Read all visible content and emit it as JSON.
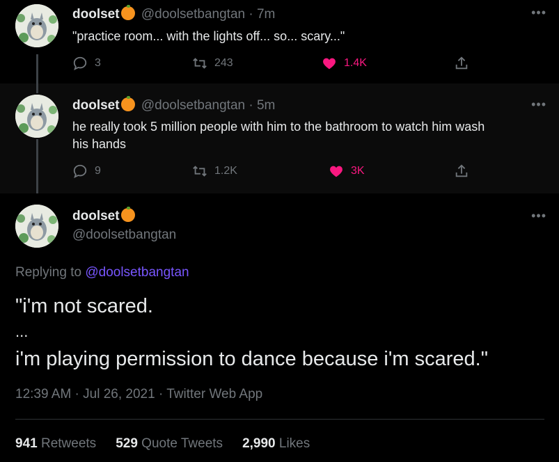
{
  "tweets": [
    {
      "name": "doolset",
      "handle": "@doolsetbangtan",
      "time": "· 7m",
      "text": "\"practice room... with the lights off... so... scary...\"",
      "replies": "3",
      "retweets": "243",
      "likes": "1.4K"
    },
    {
      "name": "doolset",
      "handle": "@doolsetbangtan",
      "time": "· 5m",
      "text_line1": "he really took 5 million people with him to the bathroom to watch him wash",
      "text_line2": "his hands",
      "replies": "9",
      "retweets": "1.2K",
      "likes": "3K"
    }
  ],
  "main": {
    "name": "doolset",
    "handle": "@doolsetbangtan",
    "replying_prefix": "Replying to",
    "replying_to": "@doolsetbangtan",
    "line1": "\"i'm not scared.",
    "line2": "...",
    "line3": "i'm playing permission to dance because i'm scared.\"",
    "timestamp": "12:39 AM · Jul 26, 2021 · Twitter Web App",
    "retweets_count": "941",
    "retweets_label": "Retweets",
    "quotes_count": "529",
    "quotes_label": "Quote Tweets",
    "likes_count": "2,990",
    "likes_label": "Likes"
  },
  "colors": {
    "like": "#f91880",
    "mention": "#7856ff",
    "muted": "#71767b"
  },
  "icons": [
    "reply-icon",
    "retweet-icon",
    "heart-icon",
    "share-icon",
    "more-icon",
    "orange-emoji-icon"
  ]
}
